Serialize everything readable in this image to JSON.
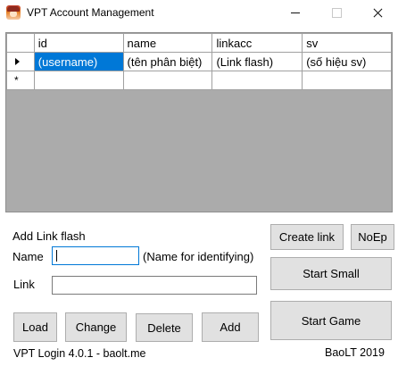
{
  "window": {
    "title": "VPT Account Management"
  },
  "grid": {
    "columns": [
      "id",
      "name",
      "linkacc",
      "sv"
    ],
    "rows": [
      [
        "(username)",
        "(tên phân biệt)",
        "(Link flash)",
        "(số hiệu sv)"
      ],
      [
        "",
        "",
        "",
        ""
      ]
    ],
    "new_row_marker": "*"
  },
  "form": {
    "section_title": "Add Link flash",
    "name_label": "Name",
    "name_value": "",
    "name_hint": "(Name for identifying)",
    "link_label": "Link",
    "link_value": ""
  },
  "buttons": {
    "load": "Load",
    "change": "Change",
    "delete": "Delete",
    "add": "Add",
    "create_link": "Create link",
    "noep": "NoEp",
    "start_small": "Start Small",
    "start_game": "Start Game"
  },
  "footer": {
    "version": "VPT Login 4.0.1 - baolt.me",
    "credit": "BaoLT 2019"
  },
  "colors": {
    "selection": "#0078d7",
    "grid_background": "#ababab",
    "button_face": "#e1e1e1"
  }
}
